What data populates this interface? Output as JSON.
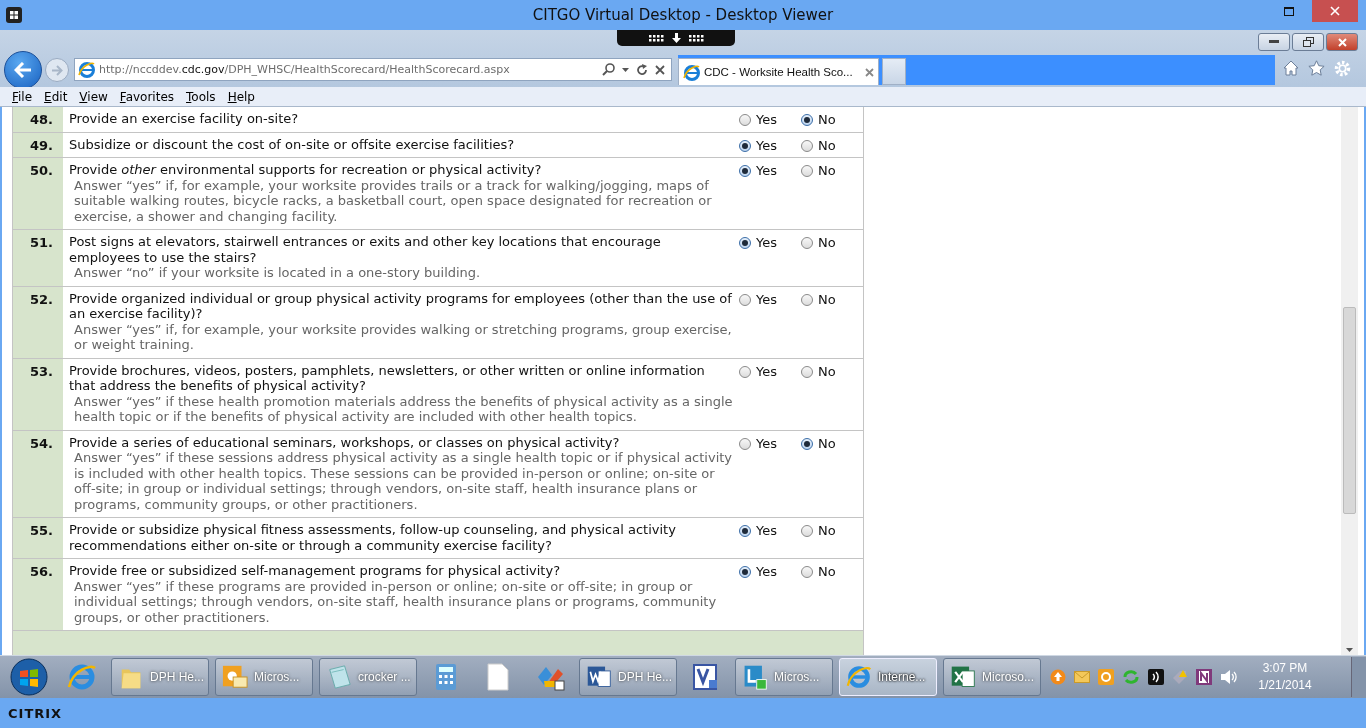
{
  "window": {
    "title": "CITGO Virtual Desktop - Desktop Viewer"
  },
  "browser": {
    "address": "http://nccddev.**cdc.gov**/DPH_WHSC/HealthScorecard/HealthScorecard.aspx",
    "tabs": [
      {
        "label": "CDC - Worksite Health Sco...",
        "selected": true
      }
    ],
    "menu": [
      "File",
      "Edit",
      "View",
      "Favorites",
      "Tools",
      "Help"
    ]
  },
  "questions": [
    {
      "number": "48.",
      "text": "Provide an exercise facility on-site?",
      "options": [
        {
          "label": "Yes",
          "selected": false
        },
        {
          "label": "No",
          "selected": true
        }
      ]
    },
    {
      "number": "49.",
      "text": "Subsidize or discount the cost of on-site or offsite exercise facilities?",
      "options": [
        {
          "label": "Yes",
          "selected": true
        },
        {
          "label": "No",
          "selected": false
        }
      ]
    },
    {
      "number": "50.",
      "text": "Provide *other* environmental supports for recreation or physical activity?",
      "hint": "Answer “yes” if, for example, your worksite provides trails or a track for walking/jogging, maps of suitable walking routes, bicycle racks, a basketball court, open space designated for recreation or exercise, a shower and changing facility.",
      "options": [
        {
          "label": "Yes",
          "selected": true
        },
        {
          "label": "No",
          "selected": false
        }
      ]
    },
    {
      "number": "51.",
      "text": "Post signs at elevators, stairwell entrances or exits and other key locations that encourage employees to use the stairs?",
      "hint": "Answer “no” if your worksite is located in a one-story building.",
      "options": [
        {
          "label": "Yes",
          "selected": true
        },
        {
          "label": "No",
          "selected": false
        }
      ]
    },
    {
      "number": "52.",
      "text": "Provide organized individual or group physical activity programs for employees (other than the use of an exercise facility)?",
      "hint": "Answer “yes” if, for example, your worksite provides walking or stretching programs, group exercise, or weight training.",
      "options": [
        {
          "label": "Yes",
          "selected": false
        },
        {
          "label": "No",
          "selected": false
        }
      ]
    },
    {
      "number": "53.",
      "text": "Provide brochures, videos, posters, pamphlets, newsletters, or other written or online information that address the benefits of physical activity?",
      "hint": "Answer “yes” if these health promotion materials address the benefits of physical activity as a single health topic or if the benefits of physical activity are included with other health topics.",
      "options": [
        {
          "label": "Yes",
          "selected": false
        },
        {
          "label": "No",
          "selected": false
        }
      ]
    },
    {
      "number": "54.",
      "text": "Provide a series of educational seminars, workshops, or classes on physical activity?",
      "hint": "Answer “yes” if these sessions address physical activity as a single health topic or if physical activity is included with other health topics. These sessions can be provided in-person or online; on-site or off-site; in group or individual settings; through vendors, on-site staff, health insurance plans or programs, community groups, or other practitioners.",
      "options": [
        {
          "label": "Yes",
          "selected": false
        },
        {
          "label": "No",
          "selected": true
        }
      ]
    },
    {
      "number": "55.",
      "text": "Provide or subsidize physical fitness assessments, follow-up counseling, and physical activity recommendations either on-site or through a community exercise facility?",
      "options": [
        {
          "label": "Yes",
          "selected": true
        },
        {
          "label": "No",
          "selected": false
        }
      ]
    },
    {
      "number": "56.",
      "text": "Provide free or subsidized self-management programs for physical activity?",
      "hint": "Answer “yes” if these programs are provided in-person or online; on-site or off-site; in group or individual settings; through vendors, on-site staff, health insurance plans or programs, community groups, or other practitioners.",
      "options": [
        {
          "label": "Yes",
          "selected": true
        },
        {
          "label": "No",
          "selected": false
        }
      ]
    }
  ],
  "taskbar": {
    "items": [
      {
        "kind": "start"
      },
      {
        "kind": "pinned"
      },
      {
        "kind": "window",
        "label": "DPH He...",
        "selected": false
      },
      {
        "kind": "window",
        "label": "Micros...",
        "selected": false
      },
      {
        "kind": "window",
        "label": "crocker ...",
        "selected": false
      },
      {
        "kind": "pinned"
      },
      {
        "kind": "pinned"
      },
      {
        "kind": "pinned"
      },
      {
        "kind": "window",
        "label": "DPH He...",
        "selected": false
      },
      {
        "kind": "pinned"
      },
      {
        "kind": "window",
        "label": "Micros...",
        "selected": false
      },
      {
        "kind": "window",
        "label": "Interne...",
        "selected": true
      },
      {
        "kind": "window",
        "label": "Microso...",
        "selected": false
      }
    ],
    "time": "3:07 PM",
    "date": "1/21/2014"
  },
  "footer": {
    "logo": "CITRIX"
  }
}
